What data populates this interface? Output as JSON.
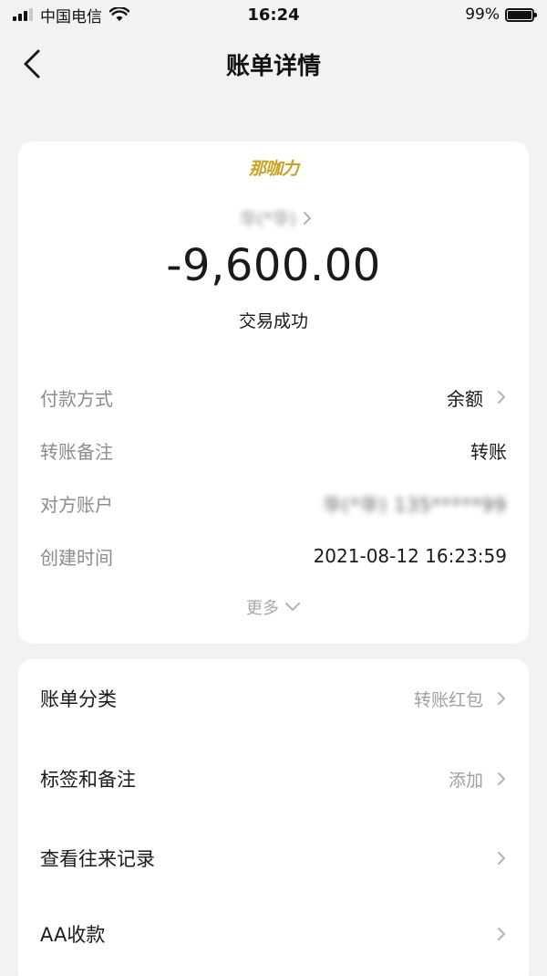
{
  "status_bar": {
    "carrier": "中国电信",
    "time": "16:24",
    "battery": "99%"
  },
  "nav": {
    "title": "账单详情"
  },
  "merchant": {
    "logo_text": "那咖力",
    "payee_name": "华(*华)"
  },
  "transaction": {
    "amount": "-9,600.00",
    "status": "交易成功"
  },
  "details": [
    {
      "label": "付款方式",
      "value": "余额"
    },
    {
      "label": "转账备注",
      "value": "转账"
    },
    {
      "label": "对方账户",
      "value": "华(*华) 135*****99"
    },
    {
      "label": "创建时间",
      "value": "2021-08-12 16:23:59"
    }
  ],
  "more_label": "更多",
  "list": [
    {
      "label": "账单分类",
      "value": "转账红包"
    },
    {
      "label": "标签和备注",
      "value": "添加"
    },
    {
      "label": "查看往来记录",
      "value": ""
    },
    {
      "label": "AA收款",
      "value": ""
    }
  ],
  "colors": {
    "background": "#f2f2f2",
    "card": "#ffffff",
    "logo_gold": "#c9a227",
    "label_gray": "#8c8c8c"
  }
}
